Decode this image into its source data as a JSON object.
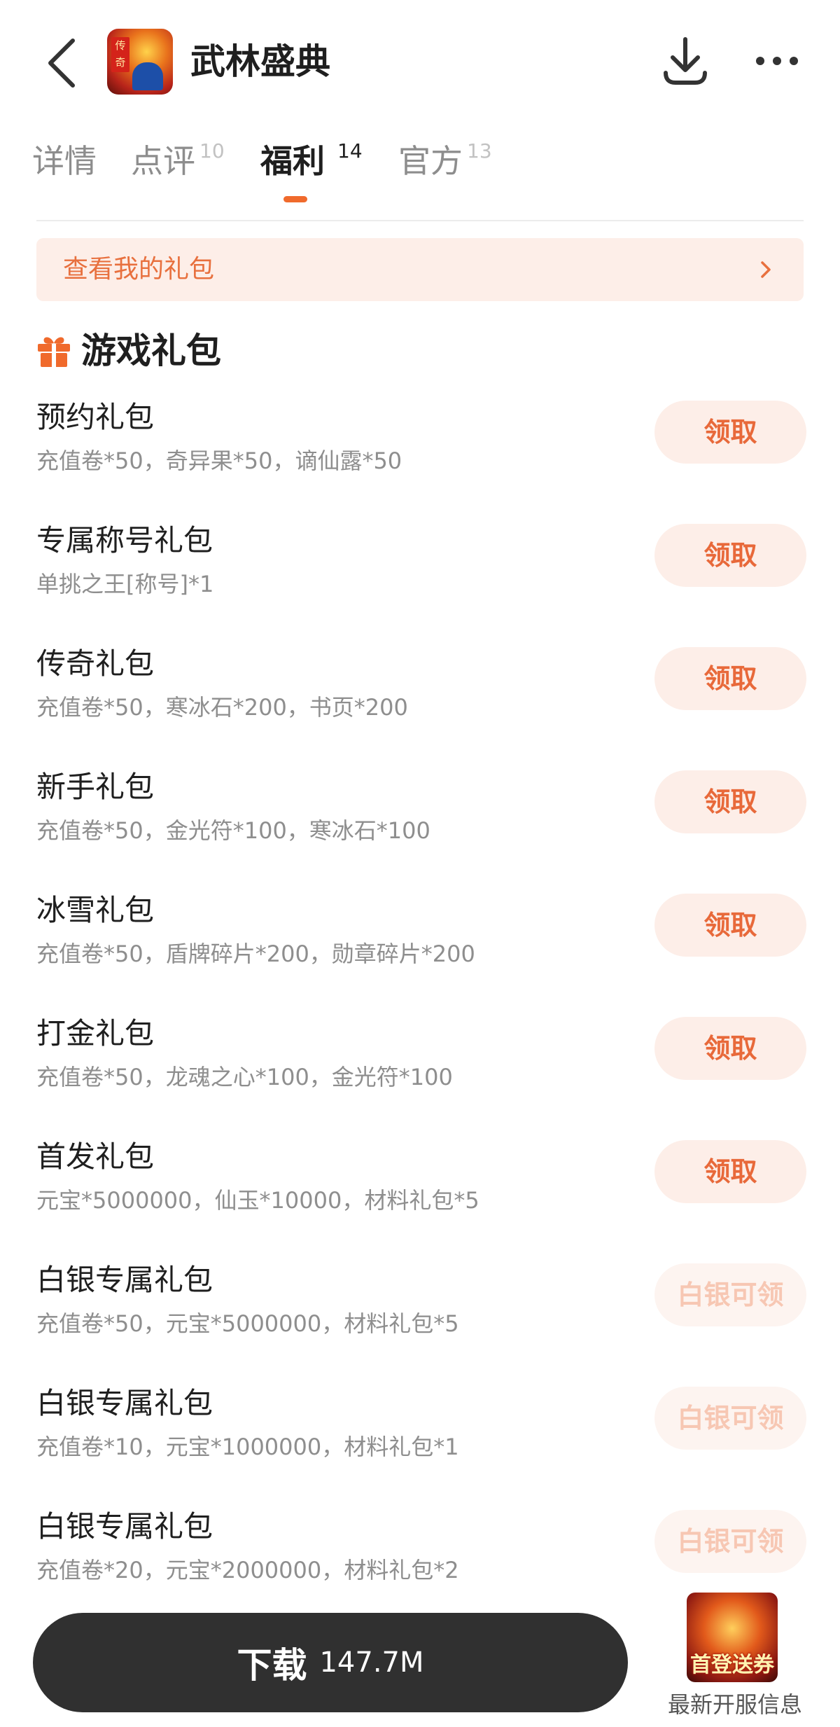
{
  "header": {
    "app_title": "武林盛典",
    "icon_seal_text": "传奇",
    "back_icon": "chevron-left-icon",
    "download_icon": "download-icon",
    "more_icon": "more-horizontal-icon"
  },
  "tabs": [
    {
      "label": "详情",
      "count": ""
    },
    {
      "label": "点评",
      "count": "10"
    },
    {
      "label": "福利",
      "count": "14",
      "active": true
    },
    {
      "label": "官方",
      "count": "13"
    }
  ],
  "my_gifts": {
    "label": "查看我的礼包",
    "chevron_icon": "chevron-right-icon"
  },
  "section": {
    "title": "游戏礼包",
    "icon": "gift-icon"
  },
  "gifts": [
    {
      "name": "预约礼包",
      "desc": "充值卷*50，奇异果*50，谪仙露*50",
      "action": "领取",
      "locked": false
    },
    {
      "name": "专属称号礼包",
      "desc": "单挑之王[称号]*1",
      "action": "领取",
      "locked": false
    },
    {
      "name": "传奇礼包",
      "desc": "充值卷*50，寒冰石*200，书页*200",
      "action": "领取",
      "locked": false
    },
    {
      "name": "新手礼包",
      "desc": "充值卷*50，金光符*100，寒冰石*100",
      "action": "领取",
      "locked": false
    },
    {
      "name": "冰雪礼包",
      "desc": "充值卷*50，盾牌碎片*200，勋章碎片*200",
      "action": "领取",
      "locked": false
    },
    {
      "name": "打金礼包",
      "desc": "充值卷*50，龙魂之心*100，金光符*100",
      "action": "领取",
      "locked": false
    },
    {
      "name": "首发礼包",
      "desc": "元宝*5000000，仙玉*10000，材料礼包*5",
      "action": "领取",
      "locked": false
    },
    {
      "name": "白银专属礼包",
      "desc": "充值卷*50，元宝*5000000，材料礼包*5",
      "action": "白银可领",
      "locked": true
    },
    {
      "name": "白银专属礼包",
      "desc": "充值卷*10，元宝*1000000，材料礼包*1",
      "action": "白银可领",
      "locked": true
    },
    {
      "name": "白银专属礼包",
      "desc": "充值卷*20，元宝*2000000，材料礼包*2",
      "action": "白银可领",
      "locked": true
    }
  ],
  "bottom": {
    "download_label": "下载",
    "download_size": "147.7M",
    "server_badge": "首登送券",
    "server_label": "最新开服信息"
  },
  "colors": {
    "accent": "#f06a2c",
    "button_text": "#e8693a",
    "button_bg": "#fdeee8",
    "locked_text": "#f7c7b3",
    "dark_bar": "#303030"
  }
}
